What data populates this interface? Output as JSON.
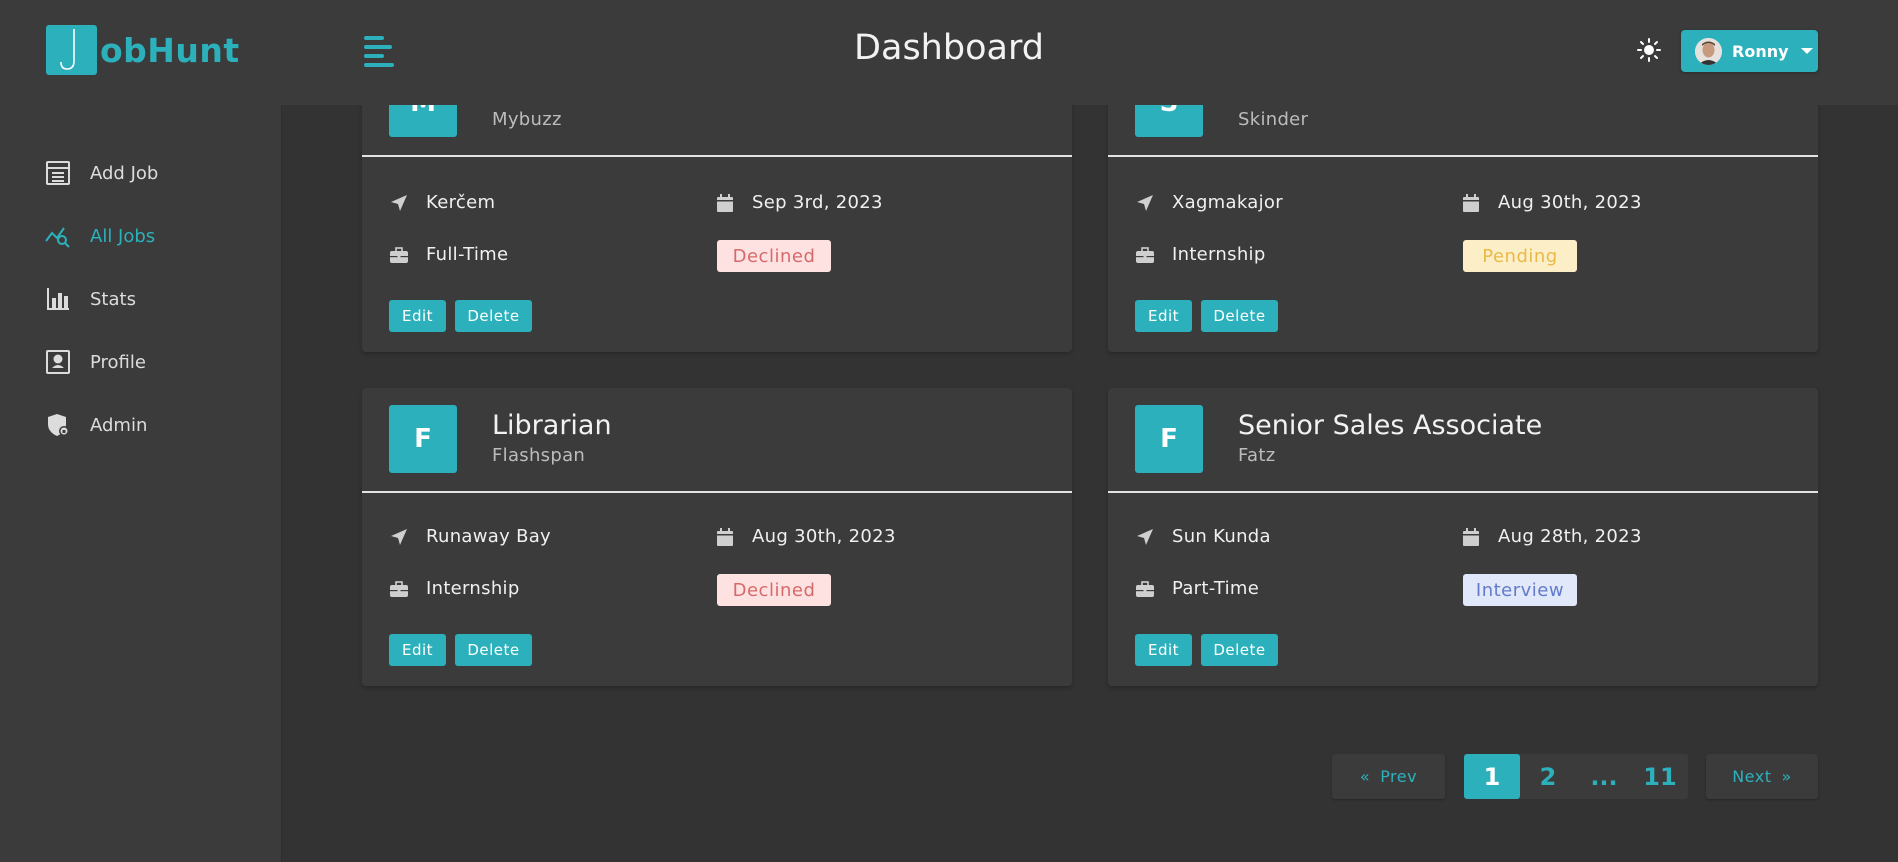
{
  "brand": {
    "logo_letter": "J",
    "logo_text": "obHunt",
    "accent": "#2cb1bc"
  },
  "header": {
    "title": "Dashboard",
    "user_name": "Ronny"
  },
  "sidebar": {
    "items": [
      {
        "label": "Add Job",
        "icon": "add-job-icon",
        "active": false
      },
      {
        "label": "All Jobs",
        "icon": "all-jobs-icon",
        "active": true
      },
      {
        "label": "Stats",
        "icon": "stats-icon",
        "active": false
      },
      {
        "label": "Profile",
        "icon": "profile-icon",
        "active": false
      },
      {
        "label": "Admin",
        "icon": "admin-icon",
        "active": false
      }
    ]
  },
  "jobs": [
    {
      "letter": "M",
      "position": "",
      "company": "Mybuzz",
      "location": "Kerčem",
      "date": "Sep 3rd, 2023",
      "type": "Full-Time",
      "status": "Declined"
    },
    {
      "letter": "S",
      "position": "",
      "company": "Skinder",
      "location": "Xagmakajor",
      "date": "Aug 30th, 2023",
      "type": "Internship",
      "status": "Pending"
    },
    {
      "letter": "F",
      "position": "Librarian",
      "company": "Flashspan",
      "location": "Runaway Bay",
      "date": "Aug 30th, 2023",
      "type": "Internship",
      "status": "Declined"
    },
    {
      "letter": "F",
      "position": "Senior Sales Associate",
      "company": "Fatz",
      "location": "Sun Kunda",
      "date": "Aug 28th, 2023",
      "type": "Part-Time",
      "status": "Interview"
    }
  ],
  "actions": {
    "edit": "Edit",
    "delete": "Delete"
  },
  "pagination": {
    "prev": "Prev",
    "next": "Next",
    "pages": [
      "1",
      "2",
      "...",
      "11"
    ],
    "current": "1"
  }
}
